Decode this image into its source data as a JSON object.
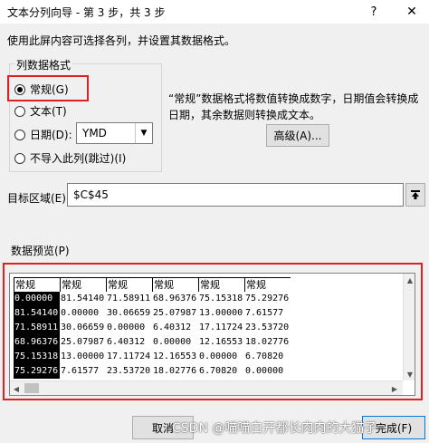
{
  "window": {
    "title": "文本分列向导 - 第 3 步，共 3 步",
    "help_label": "?",
    "close_label": "✕"
  },
  "instruction": "使用此屏内容可选择各列，并设置其数据格式。",
  "column_format": {
    "legend": "列数据格式",
    "options": [
      {
        "label": "常规(G)",
        "checked": true
      },
      {
        "label": "文本(T)",
        "checked": false
      },
      {
        "label": "日期(D):",
        "checked": false
      },
      {
        "label": "不导入此列(跳过)(I)",
        "checked": false
      }
    ],
    "date_format_value": "YMD"
  },
  "description": "“常规”数据格式将数值转换成数字，日期值会转换成日期，其余数据则转换成文本。",
  "advanced_button": "高级(A)...",
  "destination": {
    "label": "目标区域(E):",
    "value": "$C$45"
  },
  "preview": {
    "label": "数据预览(P)",
    "headers": [
      "常规",
      "常规",
      "常规",
      "常规",
      "常规",
      "常规"
    ],
    "rows": [
      [
        "0.00000",
        "81.54140",
        "71.58911",
        "68.96376",
        "75.15318",
        "75.29276"
      ],
      [
        "81.54140",
        "0.00000",
        "30.06659",
        "25.07987",
        "13.00000",
        "7.61577"
      ],
      [
        "71.58911",
        "30.06659",
        "0.00000",
        "6.40312",
        "17.11724",
        "23.53720"
      ],
      [
        "68.96376",
        "25.07987",
        "6.40312",
        "0.00000",
        "12.16553",
        "18.02776"
      ],
      [
        "75.15318",
        "13.00000",
        "17.11724",
        "12.16553",
        "0.00000",
        "6.70820"
      ],
      [
        "75.29276",
        "7.61577",
        "23.53720",
        "18.02776",
        "6.70820",
        "0.00000"
      ]
    ]
  },
  "buttons": {
    "cancel": "取消",
    "finish": "完成(F)"
  },
  "watermark": "CSDN @喵喵白开都长肉肉的大猫子",
  "colors": {
    "highlight_border": "#e02020",
    "selected_column_bg": "#000000"
  }
}
